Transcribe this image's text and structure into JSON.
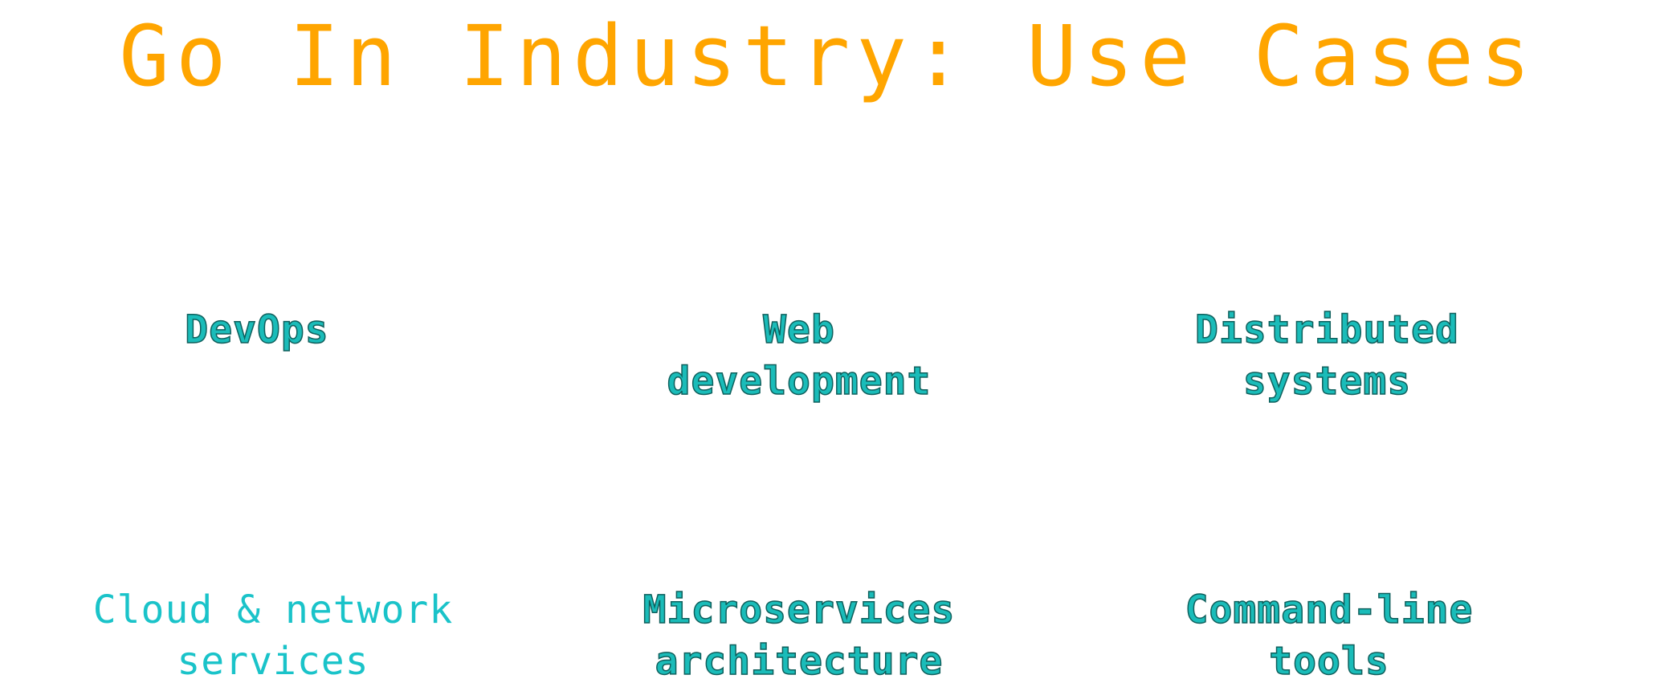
{
  "slide": {
    "title": "Go In Industry: Use Cases",
    "use_cases": [
      "DevOps",
      "Web development",
      "Distributed systems",
      "Cloud & network services",
      "Microservices architecture",
      "Command-line tools"
    ]
  },
  "colors": {
    "title": "#FFA500",
    "use_case_text": "#1ABCB9",
    "use_case_outline": "#0F5F5C",
    "background": "#FFFFFF"
  }
}
